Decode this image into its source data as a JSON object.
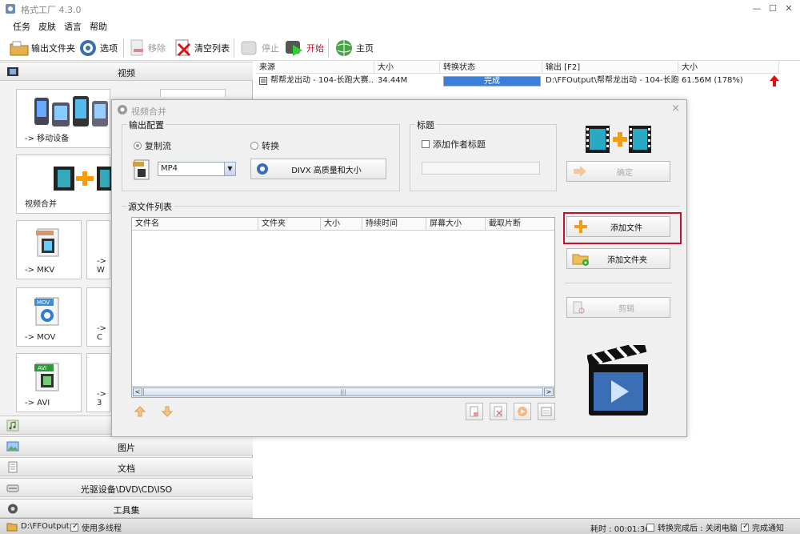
{
  "window": {
    "title": "格式工厂 4.3.0",
    "minimize": "—",
    "maximize": "☐",
    "close": "✕"
  },
  "menu": [
    "任务",
    "皮肤",
    "语言",
    "帮助"
  ],
  "toolbar": {
    "output_folder": "输出文件夹",
    "options": "选项",
    "remove": "移除",
    "clear_list": "清空列表",
    "stop": "停止",
    "start": "开始",
    "home": "主页"
  },
  "categories": {
    "video": "视频",
    "picture": "图片",
    "document": "文档",
    "optical": "光驱设备\\DVD\\CD\\ISO",
    "tools": "工具集"
  },
  "video_tiles": {
    "mobile": "-> 移动设备",
    "merge": "视频合并",
    "mkv": "-> MKV",
    "w": "-> W",
    "mov": "-> MOV",
    "c": "-> C",
    "avi": "-> AVI",
    "three": "-> 3"
  },
  "tile_badges": {
    "mov": "MOV",
    "avi": "AVI"
  },
  "file_table": {
    "headers": [
      "来源",
      "大小",
      "转换状态",
      "输出 [F2]",
      "大小"
    ],
    "rows": [
      {
        "source": "帮帮龙出动 - 104-长跑大赛...",
        "size": "34.44M",
        "status": "完成",
        "output": "D:\\FFOutput\\帮帮龙出动 - 104-长跑...",
        "out_size": "61.56M (178%)",
        "progress": 1.0
      }
    ]
  },
  "dialog": {
    "title": "视频合并",
    "close": "×",
    "output_config": "输出配置",
    "radio_copy": "复制流",
    "radio_convert": "转换",
    "format_value": "MP4",
    "quality_button": "DIVX 高质量和大小",
    "title_group": "标题",
    "add_author_title": "添加作者标题",
    "title_input": "",
    "confirm": "确定",
    "source_list": "源文件列表",
    "list_headers": [
      "文件名",
      "文件夹",
      "大小",
      "持续时间",
      "屏幕大小",
      "截取片断"
    ],
    "add_file": "添加文件",
    "add_folder": "添加文件夹",
    "clip": "剪辑",
    "scroll_left": "<",
    "scroll_right": ">",
    "scroll_grip": "|||"
  },
  "statusbar": {
    "output_path": "D:\\FFOutput",
    "multithread": "使用多线程",
    "elapsed": "耗时 : 00:01:36",
    "after_convert": "转换完成后 : 关闭电脑",
    "notify": "完成通知"
  },
  "colors": {
    "progress": "#3b7fd8",
    "highlight": "#c8102e",
    "up_arrow": "#d11"
  }
}
